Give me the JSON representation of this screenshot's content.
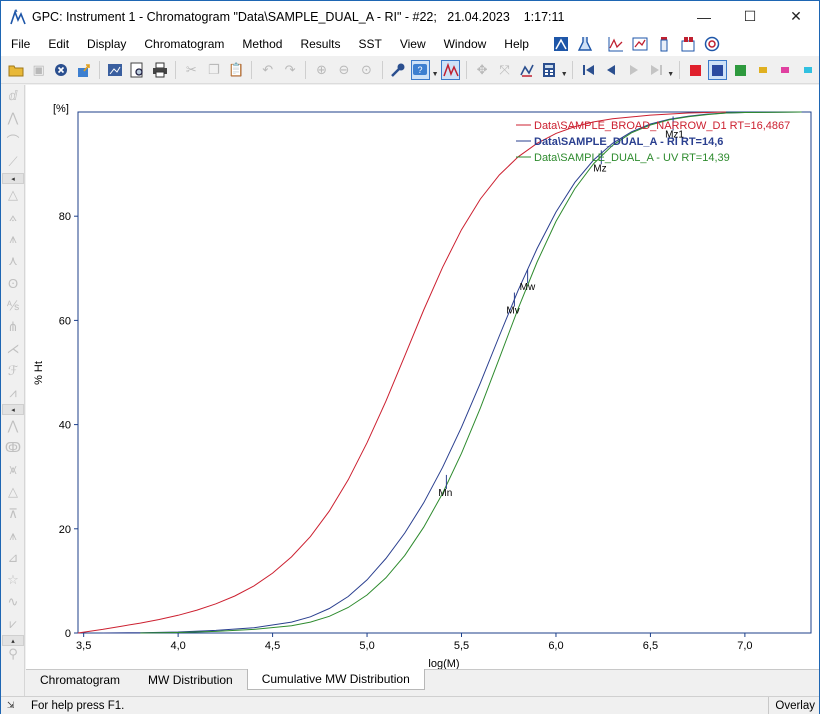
{
  "window": {
    "title": "GPC: Instrument 1 - Chromatogram \"Data\\SAMPLE_DUAL_A - RI\" - #22;   21.04.2023    1:17:11",
    "minimize": "—",
    "maximize": "☐",
    "close": "✕"
  },
  "menu": {
    "items": [
      {
        "label": "File",
        "name": "menu-file"
      },
      {
        "label": "Edit",
        "name": "menu-edit"
      },
      {
        "label": "Display",
        "name": "menu-display"
      },
      {
        "label": "Chromatogram",
        "name": "menu-chromatogram"
      },
      {
        "label": "Method",
        "name": "menu-method"
      },
      {
        "label": "Results",
        "name": "menu-results"
      },
      {
        "label": "SST",
        "name": "menu-sst"
      },
      {
        "label": "View",
        "name": "menu-view"
      },
      {
        "label": "Window",
        "name": "menu-window"
      },
      {
        "label": "Help",
        "name": "menu-help"
      }
    ]
  },
  "tabs": [
    {
      "label": "Chromatogram",
      "active": false
    },
    {
      "label": "MW Distribution",
      "active": false
    },
    {
      "label": "Cumulative MW Distribution",
      "active": true
    }
  ],
  "status": {
    "help": "For help press F1.",
    "mode": "Overlay"
  },
  "colors": {
    "series_red": "#cc2030",
    "series_blue": "#2a3f8f",
    "series_green": "#2e8b2e",
    "axis": "#1c3f8a"
  },
  "chart_data": {
    "type": "line",
    "title": "",
    "xlabel": "log(M)",
    "ylabel": "% Ht",
    "y_unit_label": "[%]",
    "xlim": [
      3.47,
      7.35
    ],
    "ylim": [
      0,
      100
    ],
    "xticks": [
      "3,5",
      "4,0",
      "4,5",
      "5,0",
      "5,5",
      "6,0",
      "6,5",
      "7,0"
    ],
    "yticks": [
      "0",
      "20",
      "40",
      "60",
      "80"
    ],
    "legend_position": "top-right",
    "series": [
      {
        "name": "Data\\SAMPLE_BROAD_NARROW_D1 RT=16,4867",
        "color": "#cc2030",
        "bold": false,
        "x": [
          3.47,
          3.6,
          3.7,
          3.8,
          3.9,
          4.0,
          4.1,
          4.2,
          4.3,
          4.4,
          4.5,
          4.6,
          4.7,
          4.8,
          4.9,
          5.0,
          5.1,
          5.2,
          5.3,
          5.4,
          5.5,
          5.6,
          5.7,
          5.8,
          5.9,
          6.0,
          6.1,
          6.2,
          6.3,
          6.5,
          6.7,
          6.9
        ],
        "y": [
          0,
          0.7,
          1.3,
          1.9,
          2.6,
          3.4,
          4.4,
          5.6,
          7.1,
          9.0,
          11.5,
          14.6,
          18.5,
          23.4,
          29.4,
          36.5,
          44.5,
          53.2,
          62.0,
          70.2,
          77.4,
          83.3,
          87.9,
          91.4,
          94.0,
          95.9,
          97.2,
          98.1,
          98.7,
          99.4,
          99.8,
          100
        ]
      },
      {
        "name": "Data\\SAMPLE_DUAL_A - RI RT=14,6",
        "color": "#2a3f8f",
        "bold": true,
        "x": [
          3.6,
          3.8,
          4.0,
          4.2,
          4.4,
          4.6,
          4.7,
          4.8,
          4.9,
          5.0,
          5.1,
          5.2,
          5.3,
          5.4,
          5.5,
          5.6,
          5.7,
          5.8,
          5.9,
          6.0,
          6.1,
          6.2,
          6.3,
          6.4,
          6.5,
          6.6,
          6.7,
          6.8,
          6.9,
          7.0,
          7.3
        ],
        "y": [
          0,
          0.05,
          0.2,
          0.5,
          1.0,
          2.1,
          3.1,
          4.7,
          7.0,
          10.2,
          14.3,
          19.2,
          25.0,
          31.8,
          39.5,
          48.0,
          57.0,
          65.8,
          73.8,
          80.8,
          86.5,
          90.8,
          94.0,
          96.2,
          97.7,
          98.6,
          99.2,
          99.6,
          99.8,
          99.9,
          100
        ]
      },
      {
        "name": "Data\\SAMPLE_DUAL_A - UV RT=14,39",
        "color": "#2e8b2e",
        "bold": false,
        "x": [
          3.8,
          4.0,
          4.2,
          4.4,
          4.6,
          4.7,
          4.8,
          4.9,
          5.0,
          5.1,
          5.2,
          5.3,
          5.4,
          5.5,
          5.6,
          5.7,
          5.8,
          5.9,
          6.0,
          6.1,
          6.2,
          6.3,
          6.4,
          6.5,
          6.6,
          6.7,
          6.8,
          6.9,
          7.0,
          7.3
        ],
        "y": [
          0,
          0.1,
          0.3,
          0.7,
          1.4,
          2.1,
          3.2,
          4.9,
          7.3,
          10.6,
          14.9,
          20.3,
          26.8,
          34.5,
          43.2,
          52.7,
          62.3,
          71.2,
          79.0,
          85.3,
          90.1,
          93.6,
          96.0,
          97.5,
          98.5,
          99.1,
          99.5,
          99.8,
          99.9,
          100
        ]
      }
    ],
    "markers": [
      {
        "label": "Mn",
        "x": 5.42,
        "y": 29.0
      },
      {
        "label": "Mv",
        "x": 5.78,
        "y": 64.0
      },
      {
        "label": "Mw",
        "x": 5.85,
        "y": 68.5
      },
      {
        "label": "Mz",
        "x": 6.24,
        "y": 91.3
      },
      {
        "label": "Mz1",
        "x": 6.62,
        "y": 97.8
      }
    ]
  }
}
